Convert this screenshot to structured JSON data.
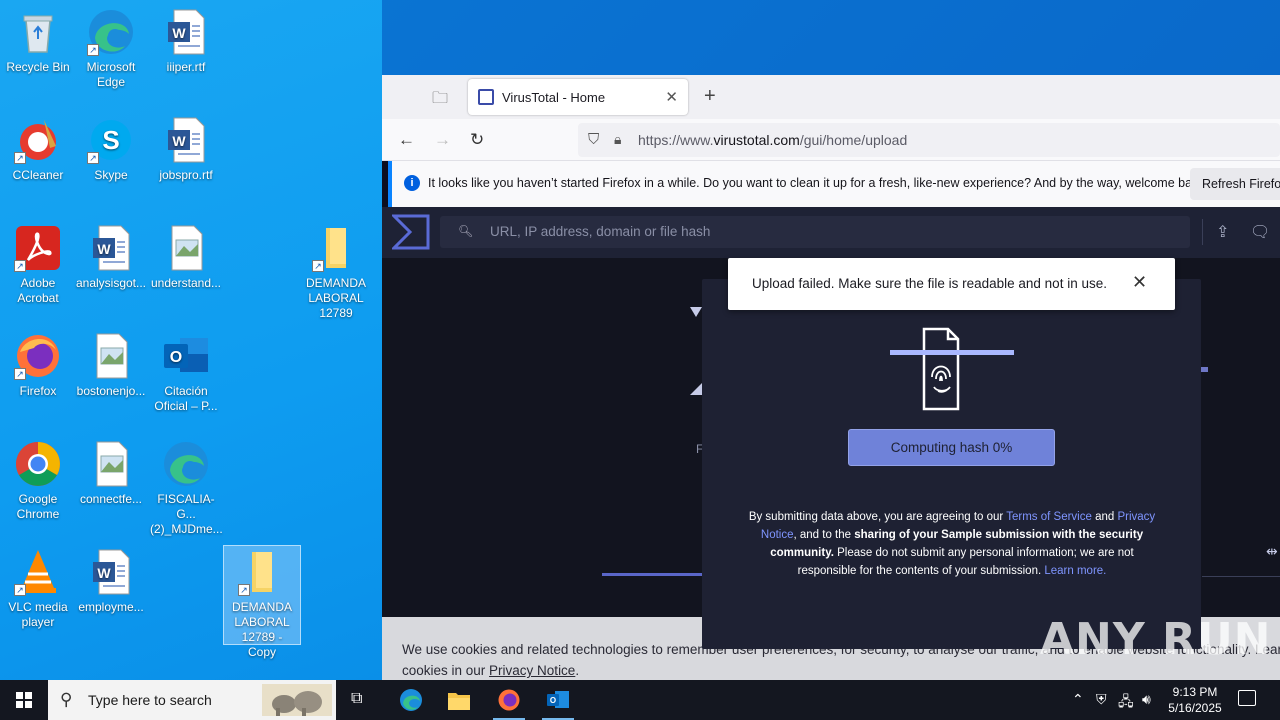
{
  "desktop": {
    "icons": [
      {
        "label": "Recycle Bin",
        "icon": "recycle-bin-icon"
      },
      {
        "label": "Microsoft Edge",
        "icon": "edge-icon"
      },
      {
        "label": "iiiper.rtf",
        "icon": "word-doc-icon"
      },
      {
        "label": "CCleaner",
        "icon": "ccleaner-icon"
      },
      {
        "label": "Skype",
        "icon": "skype-icon"
      },
      {
        "label": "jobspro.rtf",
        "icon": "word-doc-icon"
      },
      {
        "label": "Adobe Acrobat",
        "icon": "acrobat-icon"
      },
      {
        "label": "analysisgot...",
        "icon": "word-doc-icon"
      },
      {
        "label": "understand...",
        "icon": "image-file-icon"
      },
      {
        "label": "DEMANDA LABORAL 12789",
        "icon": "folder-icon"
      },
      {
        "label": "Firefox",
        "icon": "firefox-icon"
      },
      {
        "label": "bostonenjo...",
        "icon": "image-file-icon"
      },
      {
        "label": "Citación Oficial – P...",
        "icon": "outlook-icon"
      },
      {
        "label": "Google Chrome",
        "icon": "chrome-icon"
      },
      {
        "label": "connectfe...",
        "icon": "image-file-icon"
      },
      {
        "label": "FISCALIA-G... (2)_MJDme...",
        "icon": "edge-icon"
      },
      {
        "label": "VLC media player",
        "icon": "vlc-icon"
      },
      {
        "label": "employme...",
        "icon": "word-doc-icon"
      },
      {
        "label": "DEMANDA LABORAL 12789 - Copy",
        "icon": "folder-icon"
      }
    ]
  },
  "browser": {
    "tab_title": "VirusTotal - Home",
    "url_prefix": "https://www.",
    "url_domain": "virustotal.com",
    "url_path": "/gui/home/upload",
    "infobar_text": "It looks like you haven’t started Firefox in a while. Do you want to clean it up for a fresh, like-new experience? And by the way, welcome back!",
    "infobar_button": "Refresh Firefox…"
  },
  "virustotal": {
    "search_placeholder": "URL, IP address, domain or file hash",
    "toast_message": "Upload failed. Make sure the file is readable and not in use.",
    "hash_button": "Computing hash 0%",
    "terms_1": "By submitting data above, you are agreeing to our ",
    "terms_link_tos": "Terms of Service",
    "terms_2": " and ",
    "terms_link_privacy": "Privacy Notice",
    "terms_3": ", and to the ",
    "terms_bold": "sharing of your Sample submission with the security community.",
    "terms_4": " Please do not submit any personal information; we are not responsible for the contents of your submission. ",
    "terms_link_learn": "Learn more.",
    "bg_tab_label": "F",
    "cookie_text_1": "We use cookies and related technologies to remember user preferences, for security, to analyse our traffic, and to enable website functionality. Learn more about",
    "cookie_text_2": "cookies in our ",
    "cookie_link": "Privacy Notice",
    "cookie_text_3": ".",
    "watermark": "ANY RUN"
  },
  "taskbar": {
    "search_placeholder": "Type here to search",
    "time": "9:13 PM",
    "date": "5/16/2025"
  }
}
